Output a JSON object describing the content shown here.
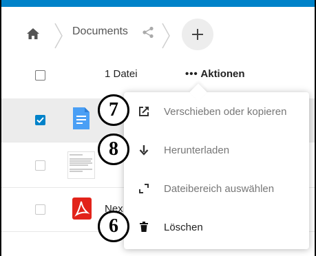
{
  "breadcrumb": {
    "folder_label": "Documents"
  },
  "list_header": {
    "count_label": "1 Datei",
    "actions_label": "Aktionen",
    "actions_dots": "•••"
  },
  "files": [
    {
      "name": "",
      "selected": true,
      "icon": "document-icon"
    },
    {
      "name": "",
      "selected": false,
      "icon": "text-thumbnail"
    },
    {
      "name": "Nex",
      "selected": false,
      "icon": "pdf-icon"
    }
  ],
  "actions_menu": {
    "items": [
      {
        "label": "Verschieben oder kopieren",
        "icon": "external-link-icon"
      },
      {
        "label": "Herunterladen",
        "icon": "download-arrow-icon"
      },
      {
        "label": "Dateibereich auswählen",
        "icon": "select-area-icon"
      },
      {
        "label": "Löschen",
        "icon": "trash-icon"
      }
    ]
  },
  "callouts": [
    "7",
    "8",
    "6"
  ],
  "colors": {
    "brand": "#0082c9",
    "pdf": "#e2231a",
    "doc": "#4a9ff5"
  }
}
